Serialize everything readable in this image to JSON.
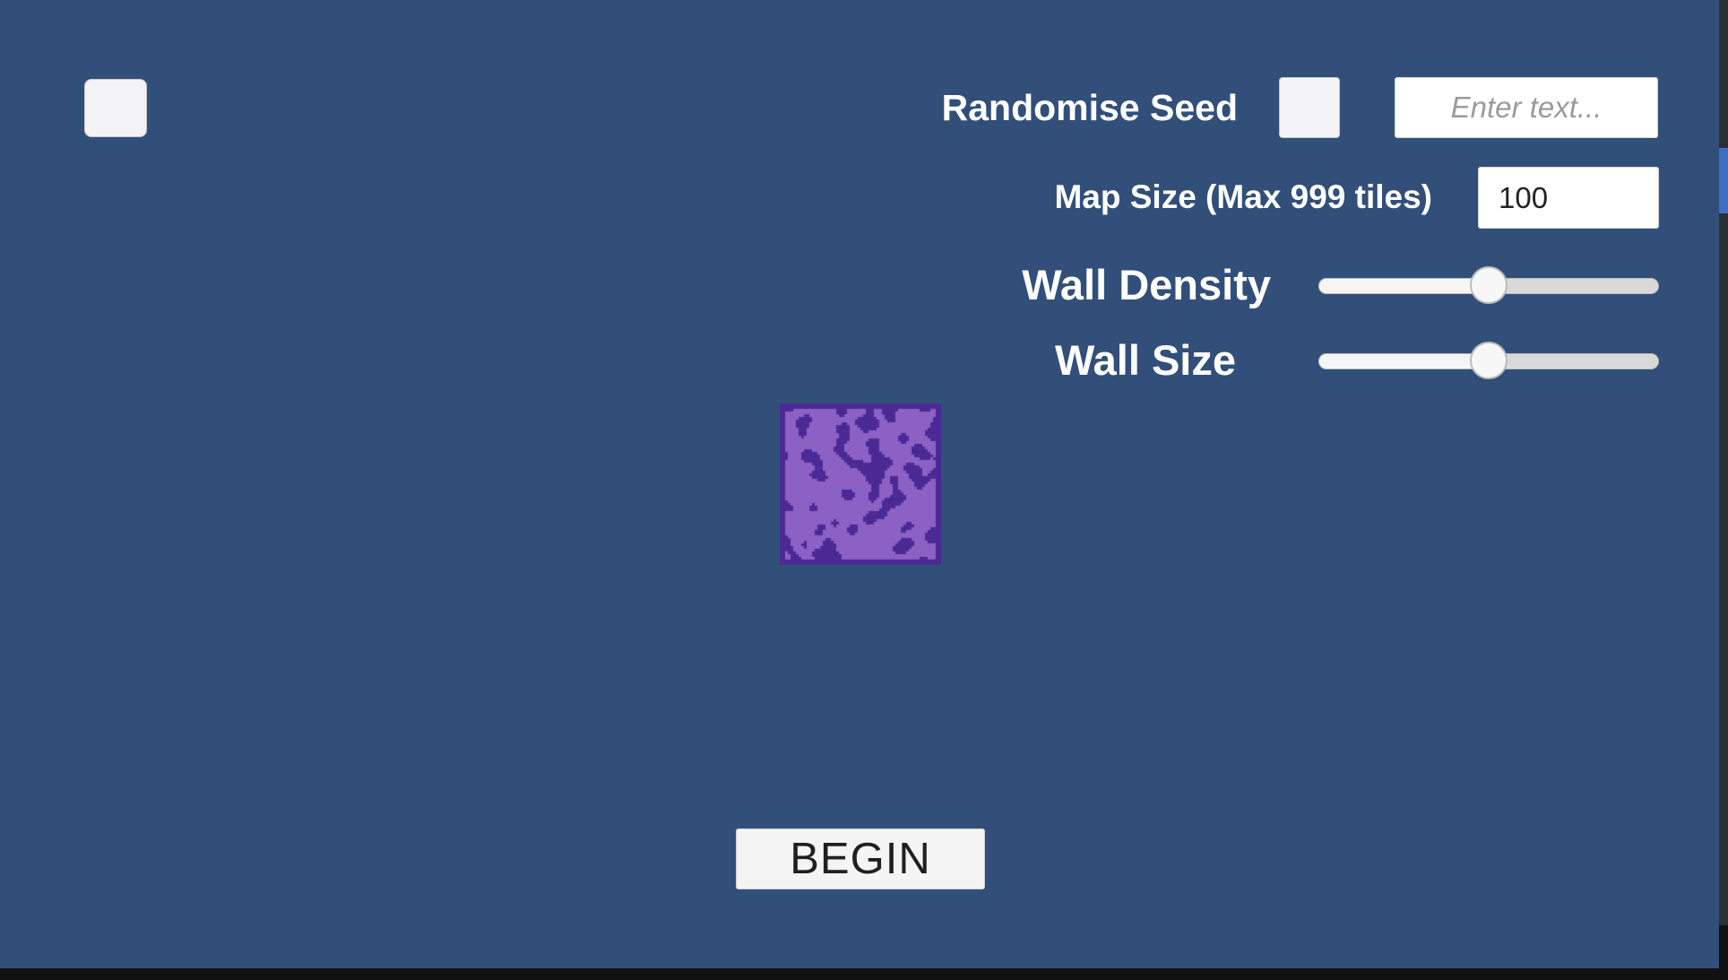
{
  "controls": {
    "randomise_seed_label": "Randomise Seed",
    "seed_placeholder": "Enter text...",
    "map_size_label": "Map Size (Max 999 tiles)",
    "map_size_value": "100",
    "wall_density_label": "Wall Density",
    "wall_density_value": 0.5,
    "wall_size_label": "Wall Size",
    "wall_size_value": 0.5
  },
  "actions": {
    "begin_label": "BEGIN"
  },
  "colors": {
    "background": "#324f7a",
    "map_floor": "#4b2a95",
    "map_wall": "#8b62c4"
  }
}
